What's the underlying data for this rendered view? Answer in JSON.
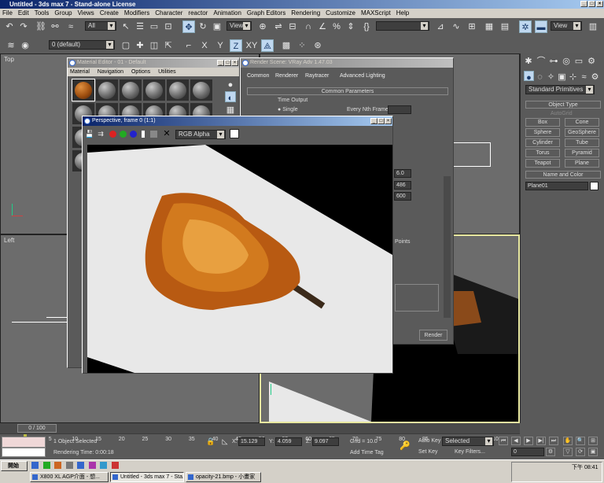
{
  "app": {
    "title": "Untitled - 3ds max 7 - Stand-alone License"
  },
  "menu": [
    "File",
    "Edit",
    "Tools",
    "Group",
    "Views",
    "Create",
    "Modifiers",
    "Character",
    "reactor",
    "Animation",
    "Graph Editors",
    "Rendering",
    "Customize",
    "MAXScript",
    "Help"
  ],
  "toolbar": {
    "selection_filter": "All",
    "ref_coord": "View",
    "named_sel": "",
    "view_dd": "View",
    "layer": "0 (default)",
    "axis_x": "X",
    "axis_y": "Y",
    "axis_z": "Z",
    "axis_xy": "XY"
  },
  "viewports": {
    "top": "Top",
    "left": "Left"
  },
  "command_panel": {
    "dropdown": "Standard Primitives",
    "object_type_title": "Object Type",
    "autogrid": "AutoGrid",
    "buttons": [
      "Box",
      "Cone",
      "Sphere",
      "GeoSphere",
      "Cylinder",
      "Tube",
      "Torus",
      "Pyramid",
      "Teapot",
      "Plane"
    ],
    "name_color_title": "Name and Color",
    "object_name": "Plane01",
    "object_color": "#ffffff"
  },
  "material_editor": {
    "title": "Material Editor - 01 - Default",
    "menu": [
      "Material",
      "Navigation",
      "Options",
      "Utilities"
    ]
  },
  "render_scene": {
    "title": "Render Scene: VRay Adv 1.47.03",
    "tabs": [
      "Common",
      "Renderer",
      "Raytracer",
      "Advanced Lighting"
    ],
    "rollout": "Common Parameters",
    "time_output": "Time Output",
    "single": "Single",
    "every_nth": "Every Nth Frame:",
    "points": "Points",
    "width_val": "486",
    "height_val": "600",
    "aperture": "6.0",
    "render_btn": "Render"
  },
  "frame_window": {
    "title": "Perspective, frame 0 (1:1)",
    "channel": "RGB Alpha"
  },
  "timeline": {
    "slider": "0 / 100",
    "ticks": [
      "0",
      "5",
      "10",
      "15",
      "20",
      "25",
      "30",
      "35",
      "40",
      "45",
      "50",
      "55",
      "60",
      "65",
      "70",
      "75",
      "80",
      "85",
      "90",
      "95",
      "100"
    ]
  },
  "status": {
    "selected": "1 Object Selected",
    "rendering_time": "Rendering Time: 0:00:18",
    "x_label": "X:",
    "x": "15.129",
    "y_label": "Y:",
    "y": "4.059",
    "z_label": "Z:",
    "z": "9.097",
    "grid": "Grid = 10.0",
    "add_time_tag": "Add Time Tag",
    "auto_key": "Auto Key",
    "set_key": "Set Key",
    "key_mode": "Selected",
    "key_filters": "Key Filters...",
    "frame": "0"
  },
  "taskbar": {
    "start": "開始",
    "clock": "下午 08:41",
    "tasks": [
      "X800 XL AGP介面 - 想...",
      "Untitled - 3ds max 7 - Sta...",
      "opacity-21.bmp - 小畫家"
    ]
  }
}
